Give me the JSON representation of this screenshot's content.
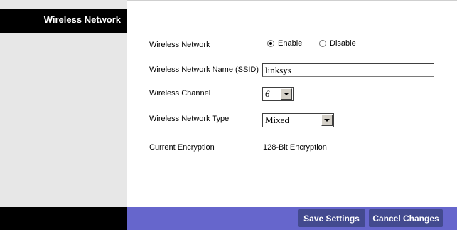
{
  "sidebar": {
    "section_title": "Wireless Network"
  },
  "form": {
    "wireless_network": {
      "label": "Wireless Network",
      "options": [
        "Enable",
        "Disable"
      ],
      "selected": "Enable"
    },
    "ssid": {
      "label": "Wireless Network Name (SSID)",
      "value": "linksys"
    },
    "channel": {
      "label": "Wireless Channel",
      "value": "6"
    },
    "network_type": {
      "label": "Wireless Network Type",
      "value": "Mixed"
    },
    "encryption": {
      "label": "Current Encryption",
      "value": "128-Bit Encryption"
    }
  },
  "footer": {
    "save_label": "Save Settings",
    "cancel_label": "Cancel Changes"
  },
  "colors": {
    "footer_bar": "#6666cc",
    "button": "#434a8f",
    "sidebar": "#e7e7e7",
    "header": "#000000"
  }
}
